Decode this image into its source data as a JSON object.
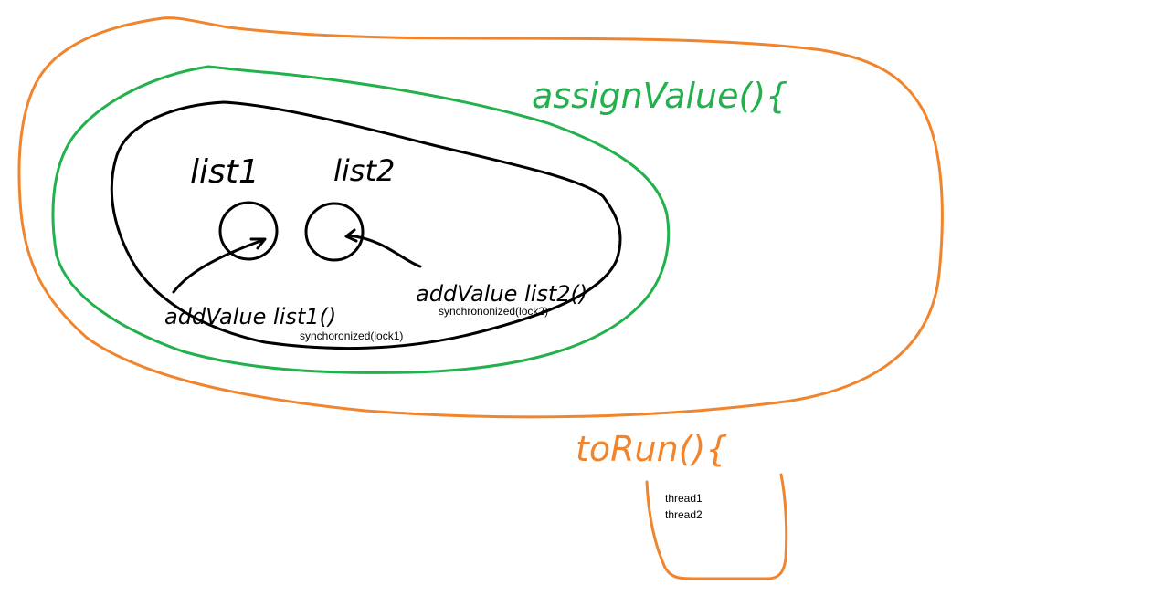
{
  "colors": {
    "outer": "#f0852d",
    "middle": "#22b14c",
    "inner": "#000000",
    "background": "#ffffff"
  },
  "labels": {
    "assign_value": "assignValue(){",
    "list1": "list1",
    "list2": "list2",
    "add_value_list1": "addValue list1()",
    "add_value_list2": "addValue list2()",
    "sync_lock1": "synchoronized(lock1)",
    "sync_lock2": "synchrononized(lock2)",
    "to_run": "toRun(){",
    "thread1": "thread1",
    "thread2": "thread2"
  }
}
